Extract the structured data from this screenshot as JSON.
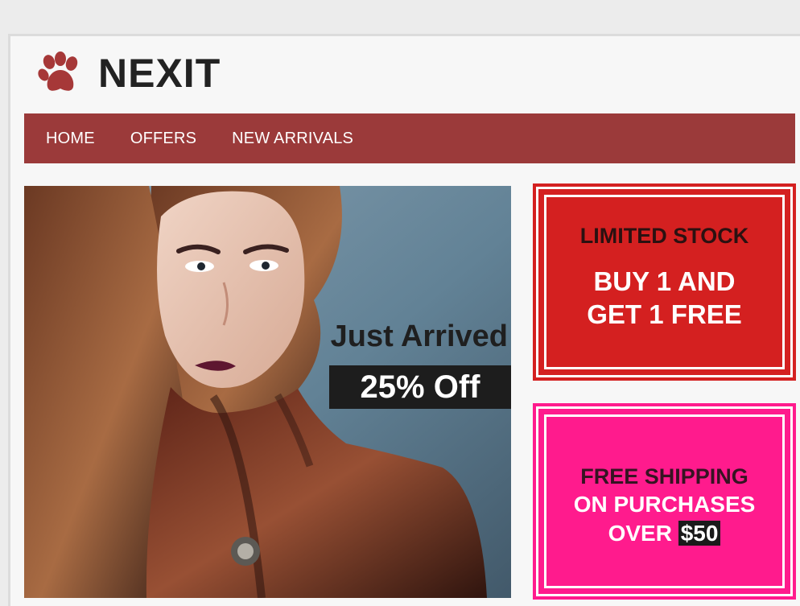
{
  "site": {
    "brand": "NEXIT",
    "logo_icon": "paw-icon"
  },
  "nav": {
    "items": [
      {
        "label": "HOME"
      },
      {
        "label": "OFFERS"
      },
      {
        "label": "NEW ARRIVALS"
      }
    ]
  },
  "hero": {
    "title": "Just Arrived",
    "offer": "25% Off"
  },
  "promos": {
    "stock": {
      "eyebrow": "LIMITED STOCK",
      "line1": "BUY 1 AND",
      "line2": "GET 1 FREE"
    },
    "shipping": {
      "eyebrow": "FREE SHIPPING",
      "line1": "ON PURCHASES",
      "line2_prefix": "OVER ",
      "amount": "$50"
    }
  },
  "colors": {
    "accent": "#9b3a3a",
    "promo_red": "#d42020",
    "promo_pink": "#ff1b8d",
    "dark": "#1d1d1d"
  }
}
